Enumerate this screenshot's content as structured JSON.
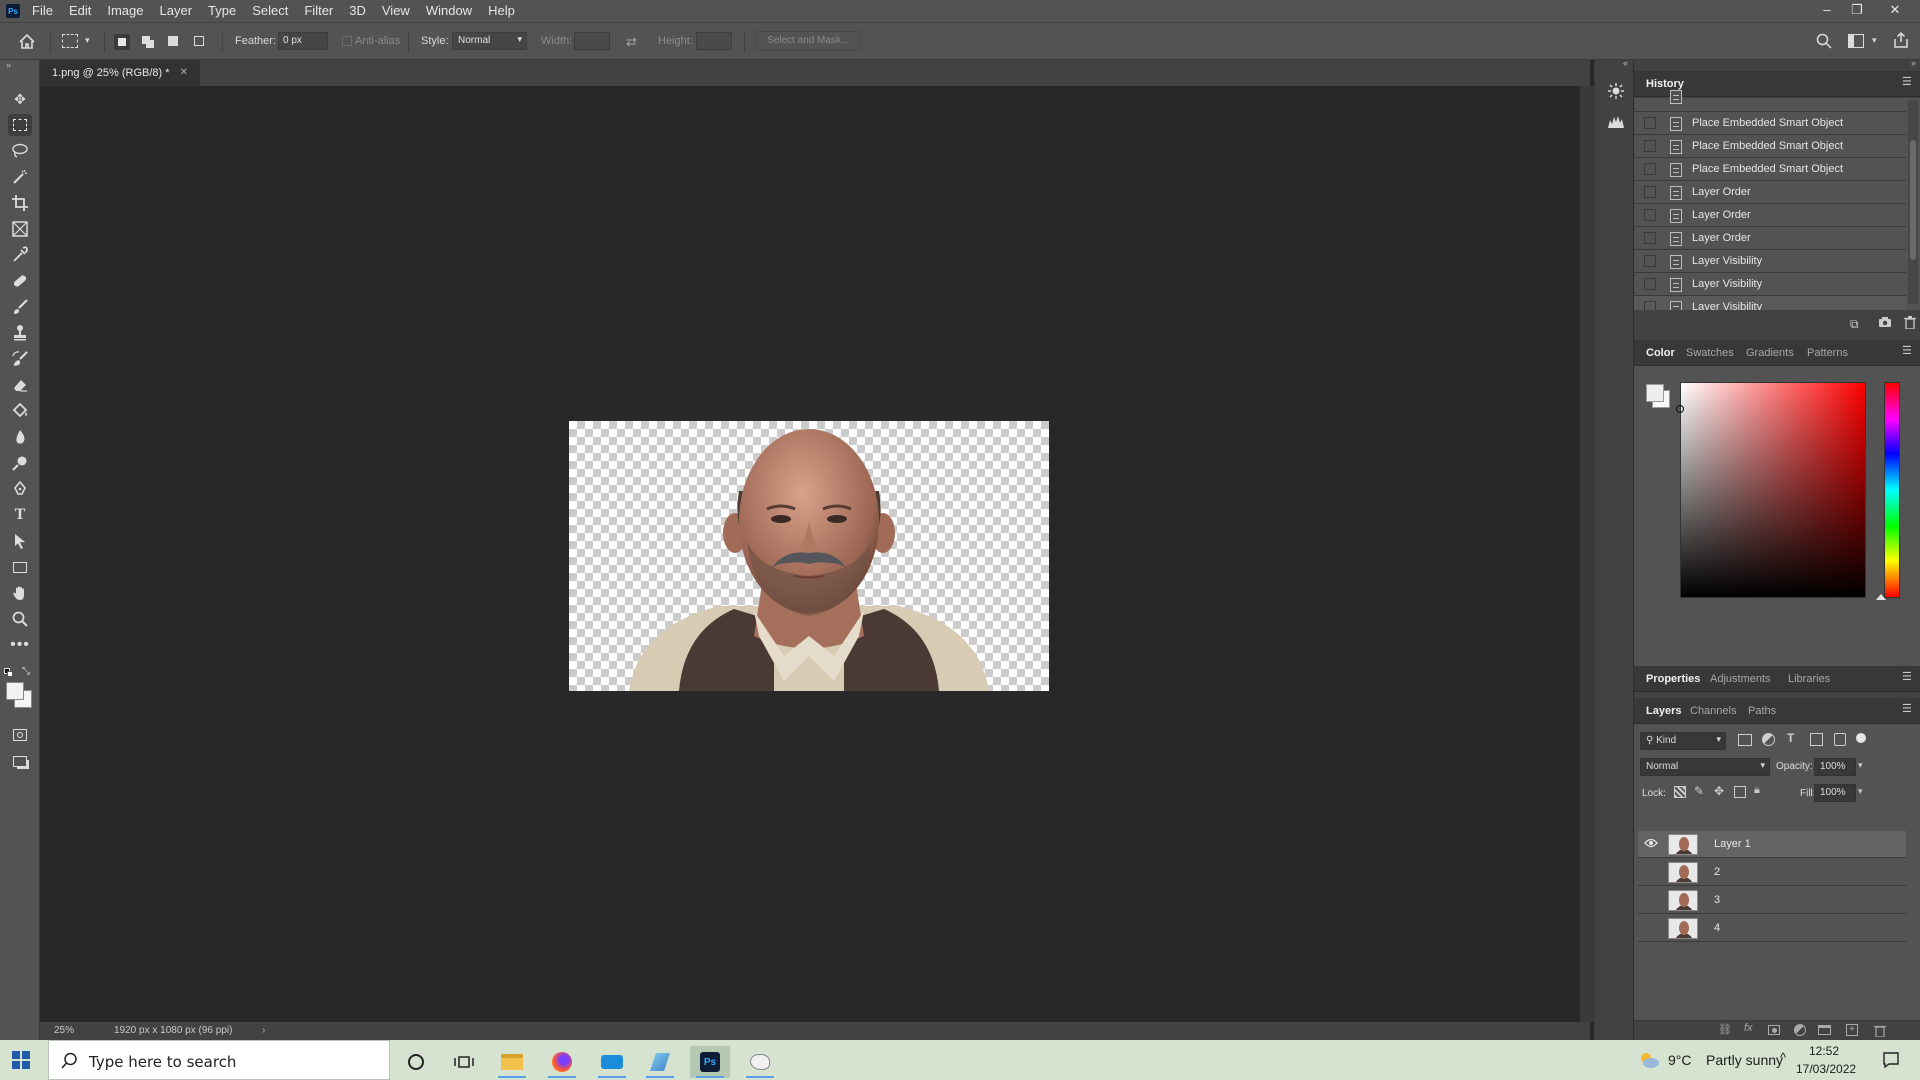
{
  "app": {
    "logo": "Ps",
    "name": "Adobe Photoshop"
  },
  "menu": [
    "File",
    "Edit",
    "Image",
    "Layer",
    "Type",
    "Select",
    "Filter",
    "3D",
    "View",
    "Window",
    "Help"
  ],
  "window_controls": {
    "minimize": "–",
    "restore": "❐",
    "close": "✕"
  },
  "options": {
    "feather_label": "Feather:",
    "feather_value": "0 px",
    "antialias_label": "Anti-alias",
    "style_label": "Style:",
    "style_value": "Normal",
    "width_label": "Width:",
    "height_label": "Height:",
    "select_mask": "Select and Mask..."
  },
  "document": {
    "tab_title": "1.png @ 25% (RGB/8) *",
    "zoom": "25%",
    "info": "1920 px x 1080 px (96 ppi)"
  },
  "history": {
    "title": "History",
    "items": [
      "Place Embedded Smart Object",
      "Place Embedded Smart Object",
      "Place Embedded Smart Object",
      "Layer Order",
      "Layer Order",
      "Layer Order",
      "Layer Visibility",
      "Layer Visibility",
      "Layer Visibility"
    ],
    "selected_index": 8
  },
  "color_panel": {
    "tabs": [
      "Color",
      "Swatches",
      "Gradients",
      "Patterns"
    ],
    "hue_color": "#ff0000"
  },
  "properties_panel": {
    "tabs": [
      "Properties",
      "Adjustments",
      "Libraries"
    ]
  },
  "layers_panel": {
    "tabs": [
      "Layers",
      "Channels",
      "Paths"
    ],
    "filter_kind": "Kind",
    "blend_mode": "Normal",
    "opacity_label": "Opacity:",
    "opacity_value": "100%",
    "lock_label": "Lock:",
    "fill_label": "Fill:",
    "fill_value": "100%",
    "layers": [
      {
        "name": "Layer 1",
        "visible": true
      },
      {
        "name": "2",
        "visible": false
      },
      {
        "name": "3",
        "visible": false
      },
      {
        "name": "4",
        "visible": false
      }
    ]
  },
  "taskbar": {
    "search_placeholder": "Type here to search",
    "weather_temp": "9°C",
    "weather_desc": "Partly sunny",
    "time": "12:52",
    "date": "17/03/2022"
  },
  "colors": {
    "ui_dark": "#282828",
    "ui_mid": "#535353",
    "panel": "#424242",
    "accent_blue": "#31a8ff",
    "taskbar": "#d5e3d0"
  }
}
